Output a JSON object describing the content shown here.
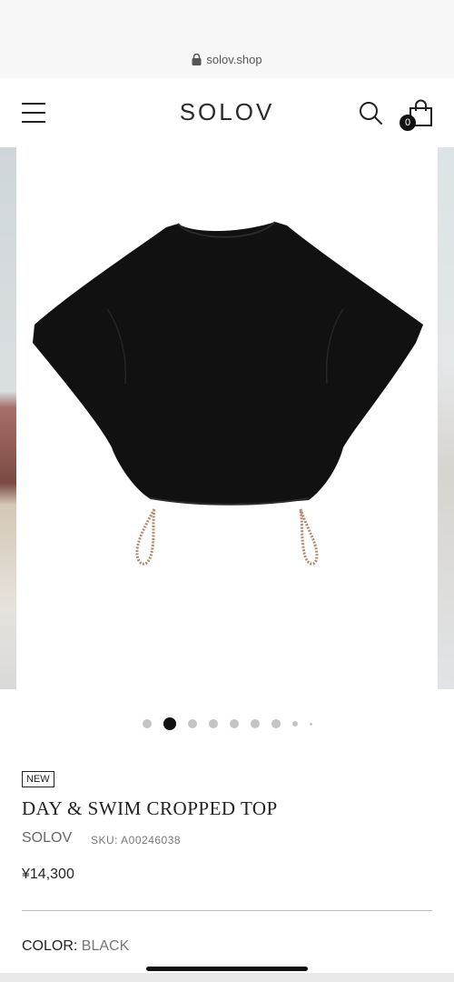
{
  "browser": {
    "url": "solov.shop"
  },
  "header": {
    "logo": "SOLOV",
    "cart_count": "0"
  },
  "gallery": {
    "dots": 9,
    "active_dot": 1
  },
  "product": {
    "badge": "NEW",
    "title": "DAY & SWIM CROPPED TOP",
    "brand": "SOLOV",
    "sku": "SKU: A00246038",
    "price": "¥14,300",
    "color_label": "COLOR: ",
    "color_value": "BLACK"
  }
}
